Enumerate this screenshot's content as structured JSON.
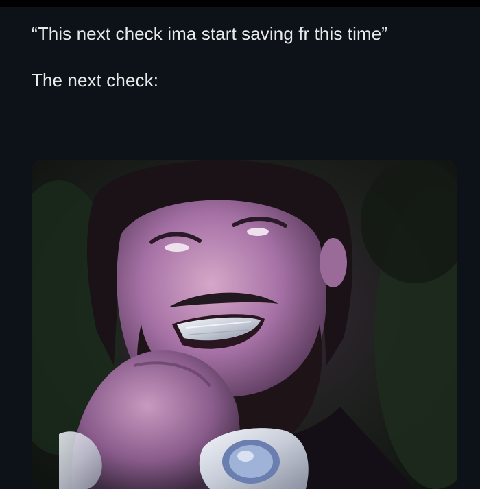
{
  "post": {
    "quote_text": "“This next check ima start saving fr this time”",
    "reply_text": "The next check:"
  },
  "media": {
    "description_icon": "photo",
    "palette": {
      "background": "#0d1218",
      "text": "#e7e9ea",
      "skin": "#b07fb0",
      "hair": "#1c1418",
      "foliage": "#1e2a1e",
      "silver": "#d8dde8"
    }
  }
}
